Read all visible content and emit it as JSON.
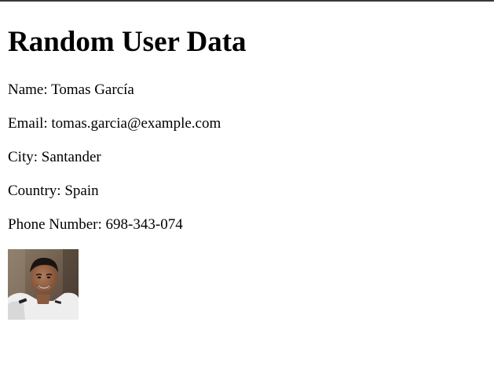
{
  "page": {
    "title": "Random User Data"
  },
  "user": {
    "name_label": "Name:",
    "name": "Tomas García",
    "email_label": "Email:",
    "email": "tomas.garcia@example.com",
    "city_label": "City:",
    "city": "Santander",
    "country_label": "Country:",
    "country": "Spain",
    "phone_label": "Phone Number:",
    "phone": "698-343-074"
  },
  "colors": {
    "text": "#000000",
    "background": "#ffffff",
    "top_border": "#3a3a3a"
  },
  "icons": {
    "photo": "user-photo"
  }
}
